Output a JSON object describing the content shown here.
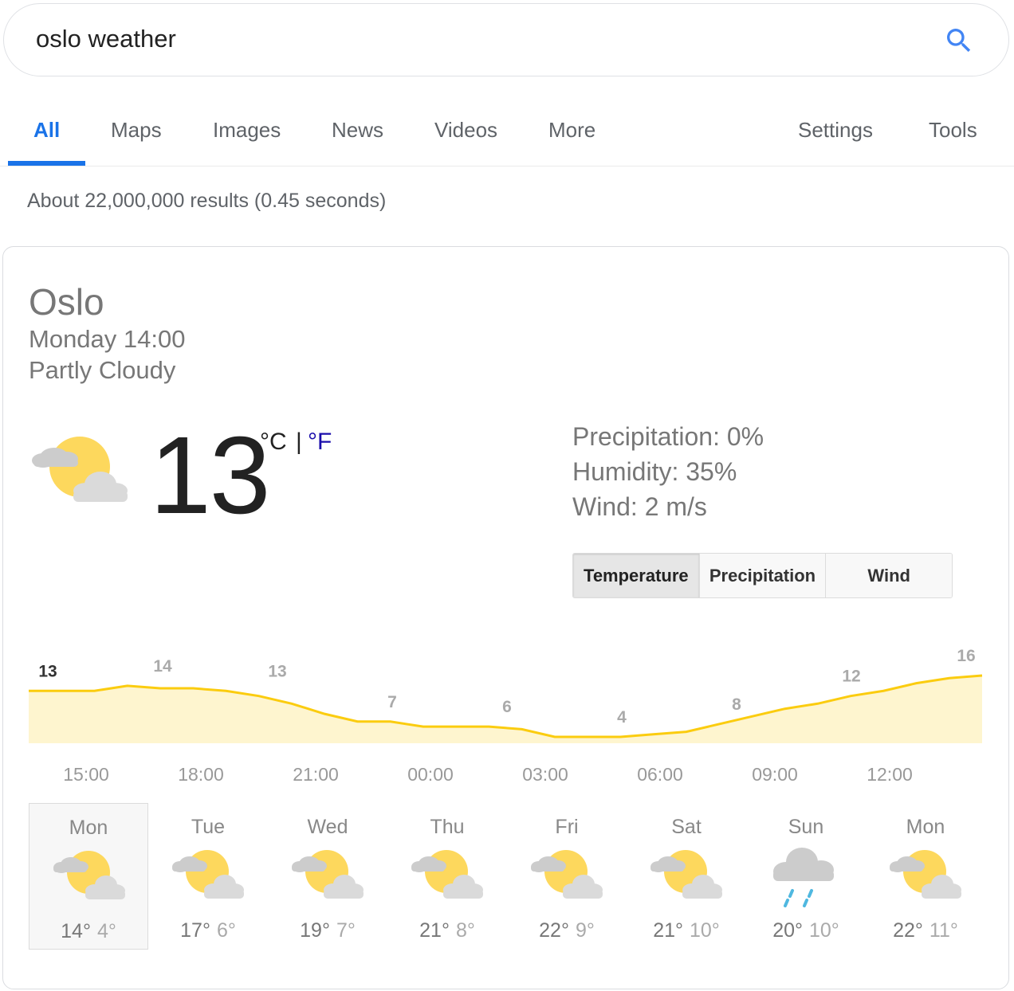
{
  "search": {
    "query": "oslo weather",
    "icon": "search-icon"
  },
  "tabs": [
    {
      "label": "All",
      "active": true
    },
    {
      "label": "Maps"
    },
    {
      "label": "Images"
    },
    {
      "label": "News"
    },
    {
      "label": "Videos"
    },
    {
      "label": "More"
    },
    {
      "label": "Settings"
    },
    {
      "label": "Tools"
    }
  ],
  "result_stats": "About 22,000,000 results (0.45 seconds)",
  "weather": {
    "city": "Oslo",
    "datetime": "Monday 14:00",
    "condition": "Partly Cloudy",
    "temperature": "13",
    "unit_c": "°C",
    "unit_sep": "|",
    "unit_f": "°F",
    "precipitation": "Precipitation: 0%",
    "humidity": "Humidity: 35%",
    "wind": "Wind: 2 m/s",
    "buttons": [
      "Temperature",
      "Precipitation",
      "Wind"
    ],
    "active_button": "Temperature",
    "accent_color": "#fbcc0f",
    "fill_color": "#fef5cf"
  },
  "chart_data": {
    "type": "area",
    "x": [
      "14:00",
      "15:00",
      "16:00",
      "17:00",
      "18:00",
      "19:00",
      "20:00",
      "21:00",
      "22:00",
      "23:00",
      "00:00",
      "01:00",
      "02:00",
      "03:00",
      "04:00",
      "05:00",
      "06:00",
      "07:00",
      "08:00",
      "09:00",
      "10:00",
      "11:00",
      "12:00",
      "13:00",
      "14:00",
      "15:00"
    ],
    "values": [
      13,
      13,
      13,
      14,
      13.5,
      13.5,
      13,
      12,
      10.5,
      8.5,
      7,
      7,
      6,
      6,
      6,
      5.5,
      4,
      4,
      4,
      4.5,
      5,
      6.5,
      8,
      9.5,
      10.5,
      12,
      13,
      14.5,
      15.5,
      16
    ],
    "value_labels": [
      "13",
      "14",
      "13",
      "7",
      "6",
      "4",
      "8",
      "12",
      "16"
    ],
    "label_indices": [
      0,
      3,
      6,
      9,
      12,
      15,
      18,
      21,
      24
    ],
    "tick_labels": [
      "15:00",
      "18:00",
      "21:00",
      "00:00",
      "03:00",
      "06:00",
      "09:00",
      "12:00"
    ]
  },
  "forecast": [
    {
      "day": "Mon",
      "hi": "14°",
      "lo": "4°",
      "icon": "partly-cloudy-icon"
    },
    {
      "day": "Tue",
      "hi": "17°",
      "lo": "6°",
      "icon": "partly-cloudy-icon"
    },
    {
      "day": "Wed",
      "hi": "19°",
      "lo": "7°",
      "icon": "partly-cloudy-icon"
    },
    {
      "day": "Thu",
      "hi": "21°",
      "lo": "8°",
      "icon": "partly-cloudy-icon"
    },
    {
      "day": "Fri",
      "hi": "22°",
      "lo": "9°",
      "icon": "partly-cloudy-icon"
    },
    {
      "day": "Sat",
      "hi": "21°",
      "lo": "10°",
      "icon": "partly-cloudy-icon"
    },
    {
      "day": "Sun",
      "hi": "20°",
      "lo": "10°",
      "icon": "rain-icon"
    },
    {
      "day": "Mon",
      "hi": "22°",
      "lo": "11°",
      "icon": "partly-cloudy-icon"
    }
  ]
}
